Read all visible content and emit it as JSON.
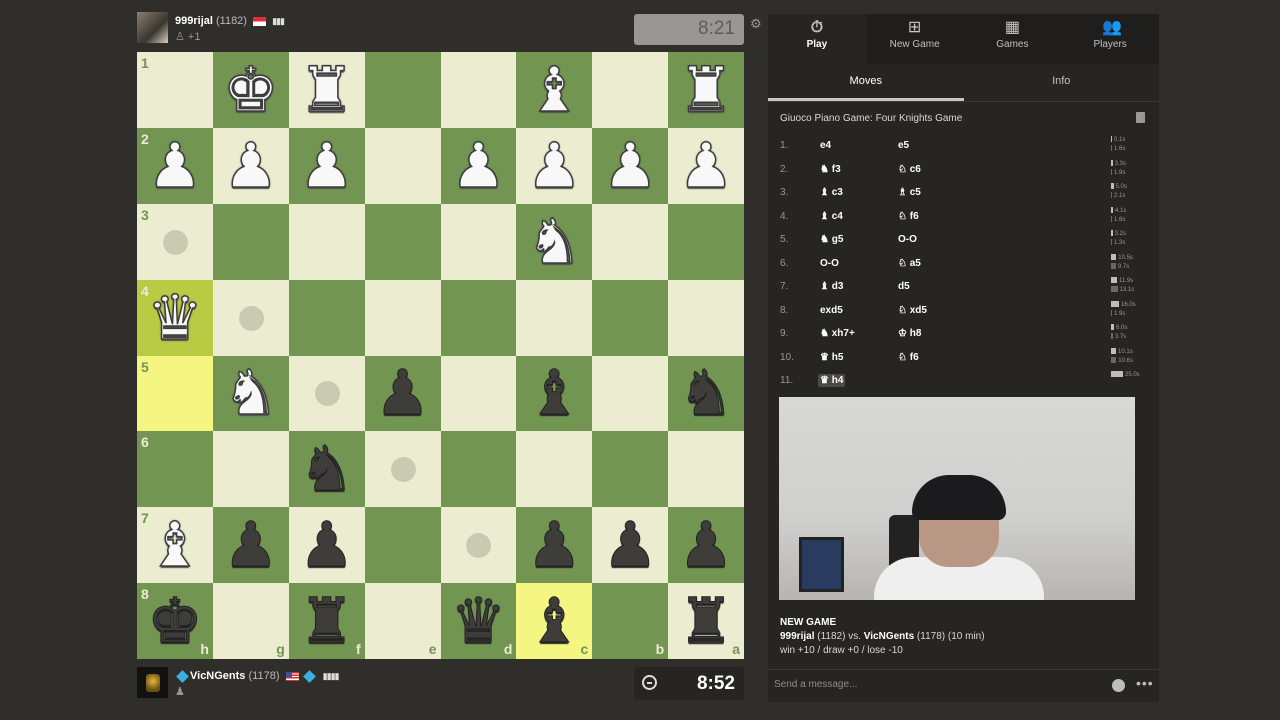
{
  "top_player": {
    "name": "999rijal",
    "rating": "(1182)",
    "sub": "+1",
    "clock": "8:21"
  },
  "bottom_player": {
    "name": "VicNGents",
    "rating": "(1178)",
    "clock": "8:52"
  },
  "nav": [
    {
      "label": "Play",
      "icon": "stopwatch-icon",
      "glyph": "⏱"
    },
    {
      "label": "New Game",
      "icon": "plus-icon",
      "glyph": "⊞"
    },
    {
      "label": "Games",
      "icon": "board-icon",
      "glyph": "▦"
    },
    {
      "label": "Players",
      "icon": "players-icon",
      "glyph": "👥"
    }
  ],
  "subtabs": [
    "Moves",
    "Info"
  ],
  "opening": "Giuoco Piano Game: Four Knights Game",
  "moves": [
    {
      "n": "1.",
      "w": "e4",
      "b": "e5"
    },
    {
      "n": "2.",
      "w": "♞ f3",
      "b": "♘ c6"
    },
    {
      "n": "3.",
      "w": "♝ c3",
      "b": "♗ c5"
    },
    {
      "n": "4.",
      "w": "♝ c4",
      "b": "♘ f6"
    },
    {
      "n": "5.",
      "w": "♞ g5",
      "b": "O-O"
    },
    {
      "n": "6.",
      "w": "O-O",
      "b": "♘ a5"
    },
    {
      "n": "7.",
      "w": "♝ d3",
      "b": "d5"
    },
    {
      "n": "8.",
      "w": "exd5",
      "b": "♘ xd5"
    },
    {
      "n": "9.",
      "w": "♞ xh7+",
      "b": "♔ h8"
    },
    {
      "n": "10.",
      "w": "♛ h5",
      "b": "♘ f6"
    },
    {
      "n": "11.",
      "w": "♛ h4",
      "b": ""
    }
  ],
  "move_times": [
    [
      "0.1s",
      "1.6s"
    ],
    [
      "3.3s",
      "1.9s"
    ],
    [
      "5.0s",
      "2.1s"
    ],
    [
      "4.1s",
      "1.6s"
    ],
    [
      "3.2s",
      "1.3s"
    ],
    [
      "10.5s",
      "9.7s"
    ],
    [
      "11.9s",
      "13.1s"
    ],
    [
      "16.0s",
      "1.9s"
    ],
    [
      "6.0s",
      "3.7s"
    ],
    [
      "10.1s",
      "10.6s"
    ],
    [
      "25.0s",
      ""
    ]
  ],
  "new_game": {
    "heading": "NEW GAME",
    "line1_a": "999rijal",
    "line1_b": " (1182) vs. ",
    "line1_c": "VicNGents",
    "line1_d": " (1178) (10 min)",
    "line2": "win +10 / draw +0 / lose -10"
  },
  "chat": {
    "placeholder": "Send a message..."
  },
  "board": {
    "ranks": [
      "1",
      "2",
      "3",
      "4",
      "5",
      "6",
      "7",
      "8"
    ],
    "files": [
      "h",
      "g",
      "f",
      "e",
      "d",
      "c",
      "b",
      "a"
    ],
    "rows": [
      [
        null,
        "wK",
        "wR",
        null,
        null,
        "wB",
        null,
        "wR"
      ],
      [
        "wP",
        "wP",
        "wP",
        null,
        "wP",
        "wP",
        "wP",
        "wP"
      ],
      [
        "dot",
        null,
        null,
        null,
        null,
        "wN",
        null,
        null
      ],
      [
        "wQ",
        "dot",
        null,
        null,
        null,
        null,
        null,
        null
      ],
      [
        null,
        "wN",
        "dot",
        "bP",
        null,
        "bB",
        null,
        "bN"
      ],
      [
        null,
        null,
        "bN",
        "dot",
        null,
        null,
        null,
        null
      ],
      [
        "wB",
        "bP",
        "bP",
        null,
        "dot",
        "bP",
        "bP",
        "bP"
      ],
      [
        "bK",
        null,
        "bR",
        null,
        "bQ",
        "bB",
        null,
        "bR"
      ]
    ],
    "highlights": [
      [
        3,
        0
      ],
      [
        4,
        0
      ],
      [
        7,
        5
      ]
    ]
  }
}
